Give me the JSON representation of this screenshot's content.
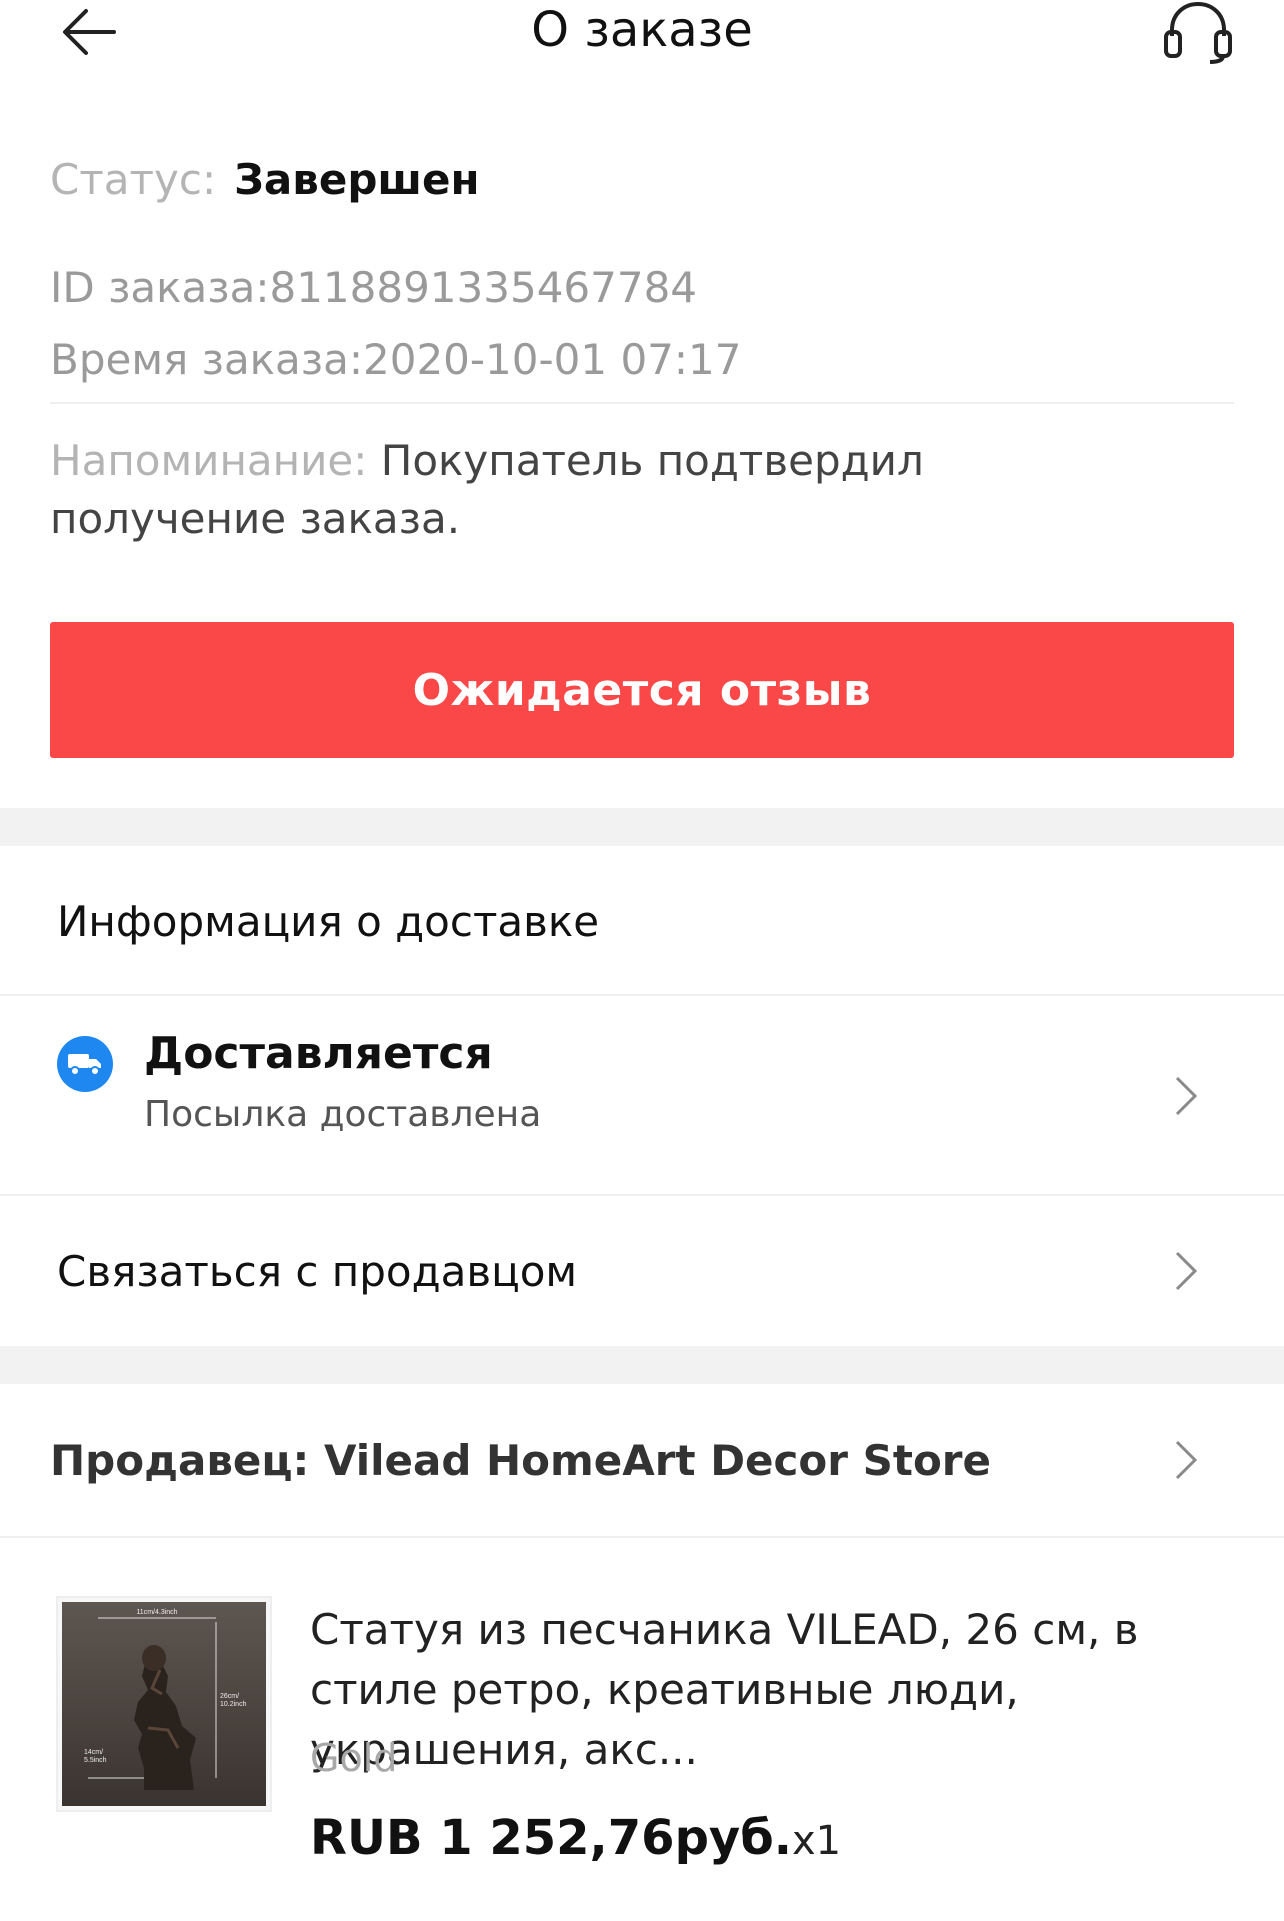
{
  "header": {
    "title": "О заказе",
    "back_icon": "arrow-left-icon",
    "support_icon": "headset-icon"
  },
  "order": {
    "status_label": "Статус:",
    "status_value": "Завершен",
    "id_line": "ID заказа:8118891335467784",
    "time_line": "Время заказа:2020-10-01 07:17",
    "reminder_label": "Напоминание:",
    "reminder_text": " Покупатель подтвердил получение заказа."
  },
  "actions": {
    "review_button": "Ожидается отзыв",
    "accent_color": "#fa4848"
  },
  "delivery": {
    "section_title": "Информация о доставке",
    "status_title": "Доставляется",
    "status_sub": "Посылка доставлена",
    "icon": "truck-icon",
    "icon_color": "#1e88f0"
  },
  "contact": {
    "label": "Связаться с продавцом"
  },
  "seller": {
    "label": "Продавец: Vilead HomeArt Decor Store"
  },
  "product": {
    "title": "Статуя из песчаника VILEAD, 26 см, в стиле ретро, креативные люди, украшения, акс...",
    "variant": "Gold",
    "price": "RUB 1 252,76руб.",
    "quantity": "x1",
    "thumb_labels": {
      "top": "11cm/4.3inch",
      "right": "26cm/\n10.2inch",
      "left": "14cm/\n5.5inch"
    }
  }
}
